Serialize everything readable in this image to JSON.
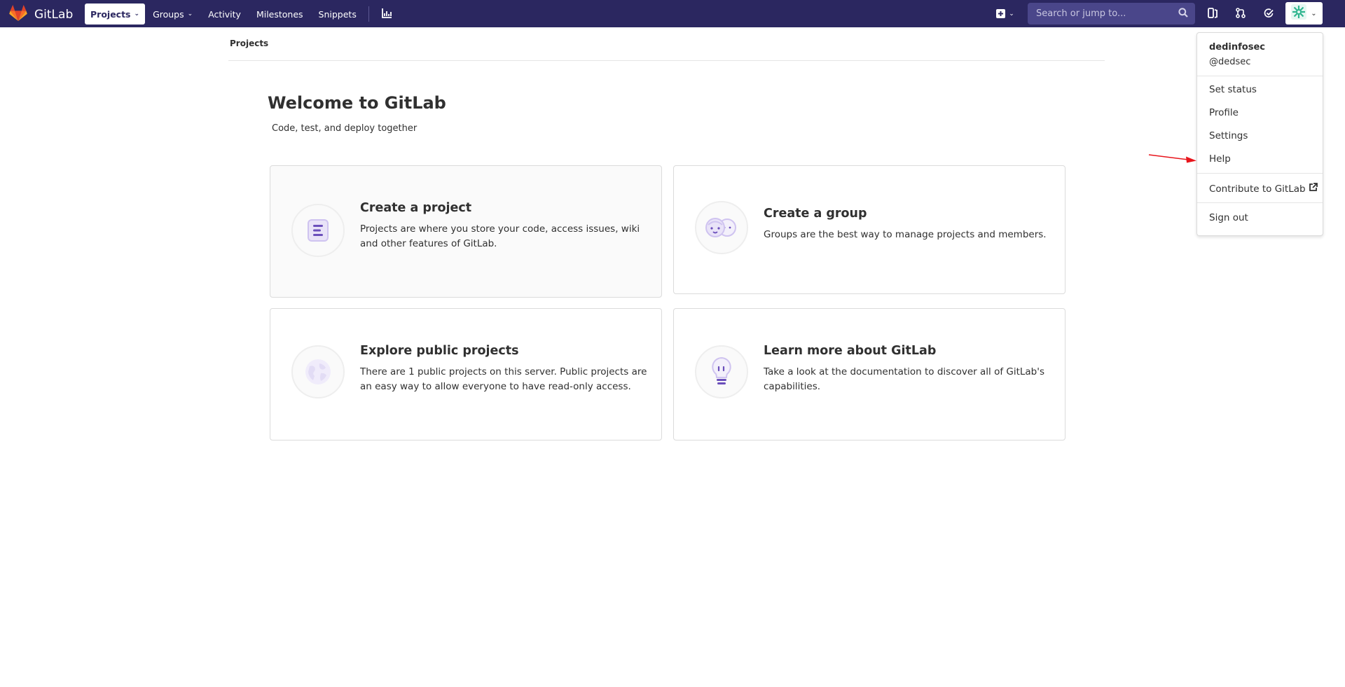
{
  "navbar": {
    "brand": "GitLab",
    "links": [
      {
        "label": "Projects",
        "active": true,
        "has_caret": true
      },
      {
        "label": "Groups",
        "active": false,
        "has_caret": true
      },
      {
        "label": "Activity",
        "active": false,
        "has_caret": false
      },
      {
        "label": "Milestones",
        "active": false,
        "has_caret": false
      },
      {
        "label": "Snippets",
        "active": false,
        "has_caret": false
      }
    ],
    "search_placeholder": "Search or jump to...",
    "icons": [
      "chart-icon",
      "plus-square-icon",
      "search-icon",
      "issues-icon",
      "merge-request-icon",
      "todo-check-icon",
      "avatar-icon"
    ],
    "colors": {
      "navbar_bg": "#2b2760",
      "search_bg": "#4a468a",
      "accent": "#6b4fbb"
    }
  },
  "breadcrumb": {
    "current": "Projects"
  },
  "welcome": {
    "title": "Welcome to GitLab",
    "subtitle": "Code, test, and deploy together"
  },
  "cards": [
    {
      "title": "Create a project",
      "text": "Projects are where you store your code, access issues, wiki and other features of GitLab.",
      "icon": "project-icon"
    },
    {
      "title": "Create a group",
      "text": "Groups are the best way to manage projects and members.",
      "icon": "group-icon"
    },
    {
      "title": "Explore public projects",
      "text": "There are 1 public projects on this server. Public projects are an easy way to allow everyone to have read-only access.",
      "icon": "globe-icon"
    },
    {
      "title": "Learn more about GitLab",
      "text": "Take a look at the documentation to discover all of GitLab's capabilities.",
      "icon": "lightbulb-icon"
    }
  ],
  "user_menu": {
    "name": "dedinfosec",
    "username": "@dedsec",
    "items": [
      "Set status",
      "Profile",
      "Settings",
      "Help",
      "Contribute to GitLab",
      "Sign out"
    ]
  },
  "annotation": {
    "color": "#e8141b",
    "points_to": "Help"
  }
}
